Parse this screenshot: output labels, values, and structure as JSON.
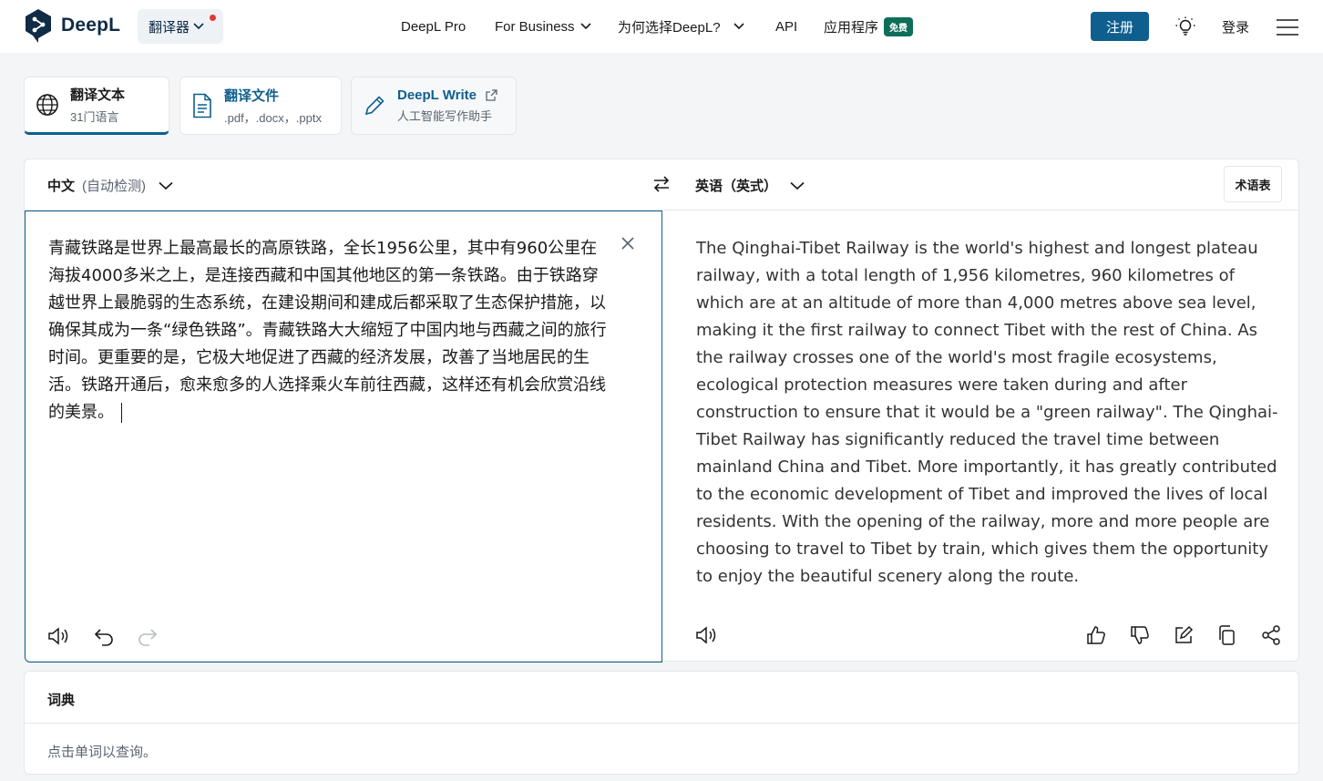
{
  "header": {
    "brand": "DeepL",
    "product_switch": "翻译器",
    "nav": [
      {
        "label": "DeepL Pro"
      },
      {
        "label": "For Business"
      },
      {
        "label": "为何选择DeepL?"
      },
      {
        "label": "API"
      },
      {
        "label": "应用程序"
      }
    ],
    "free_badge": "免费",
    "signup": "注册",
    "login": "登录"
  },
  "modes": [
    {
      "title": "翻译文本",
      "subtitle": "31门语言"
    },
    {
      "title": "翻译文件",
      "subtitle": ".pdf，.docx，.pptx"
    },
    {
      "title": "DeepL Write",
      "subtitle": "人工智能写作助手"
    }
  ],
  "translator": {
    "source_lang": "中文",
    "source_detect": "(自动检测)",
    "target_lang": "英语（英式）",
    "glossary": "术语表",
    "source_text": "青藏铁路是世界上最高最长的高原铁路，全长1956公里，其中有960公里在海拔4000多米之上，是连接西藏和中国其他地区的第一条铁路。由于铁路穿越世界上最脆弱的生态系统，在建设期间和建成后都采取了生态保护措施，以确保其成为一条“绿色铁路”。青藏铁路大大缩短了中国内地与西藏之间的旅行时间。更重要的是，它极大地促进了西藏的经济发展，改善了当地居民的生活。铁路开通后，愈来愈多的人选择乘火车前往西藏，这样还有机会欣赏沿线的美景。",
    "target_text": "The Qinghai-Tibet Railway is the world's highest and longest plateau railway, with a total length of 1,956 kilometres, 960 kilometres of which are at an altitude of more than 4,000 metres above sea level, making it the first railway to connect Tibet with the rest of China. As the railway crosses one of the world's most fragile ecosystems, ecological protection measures were taken during and after construction to ensure that it would be a \"green railway\". The Qinghai-Tibet Railway has significantly reduced the travel time between mainland China and Tibet. More importantly, it has greatly contributed to the economic development of Tibet and improved the lives of local residents. With the opening of the railway, more and more people are choosing to travel to Tibet by train, which gives them the opportunity to enjoy the beautiful scenery along the route."
  },
  "dictionary": {
    "title": "词典",
    "hint": "点击单词以查询。"
  },
  "colors": {
    "brand_navy": "#0f2b46",
    "accent_blue": "#0f5f8e",
    "free_badge_green": "#0f6e5a",
    "notification_red": "#e53935"
  },
  "icons": [
    "deepl-logo-icon",
    "chevron-down-icon",
    "lightbulb-icon",
    "menu-icon",
    "globe-icon",
    "document-icon",
    "pen-icon",
    "external-link-icon",
    "swap-icon",
    "close-icon",
    "speaker-icon",
    "undo-icon",
    "redo-icon",
    "thumbs-up-icon",
    "thumbs-down-icon",
    "edit-icon",
    "copy-icon",
    "share-icon"
  ]
}
